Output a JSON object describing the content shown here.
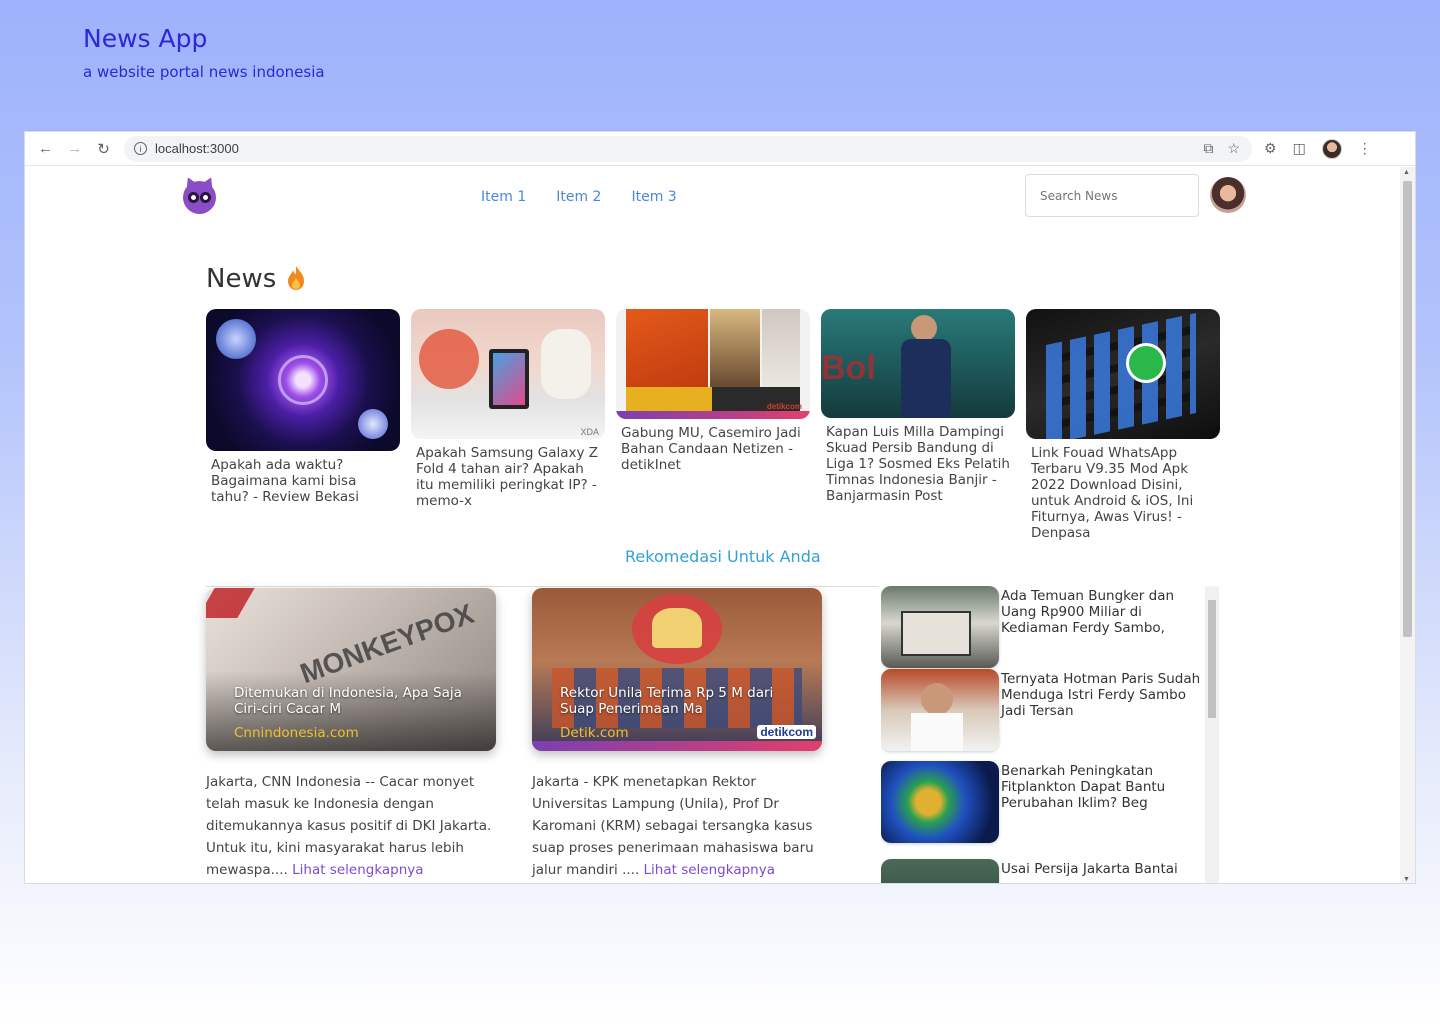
{
  "hero": {
    "title": "News App",
    "subtitle": "a website portal news indonesia"
  },
  "browser": {
    "url": "localhost:3000"
  },
  "nav": {
    "items": [
      "Item 1",
      "Item 2",
      "Item 3"
    ],
    "search_placeholder": "Search News"
  },
  "news": {
    "heading": "News",
    "cards": [
      {
        "caption": "Apakah ada waktu? Bagaimana kami bisa tahu? - Review Bekasi"
      },
      {
        "caption": "Apakah Samsung Galaxy Z Fold 4 tahan air? Apakah itu memiliki peringkat IP? - memo-x"
      },
      {
        "caption": "Gabung MU, Casemiro Jadi Bahan Candaan Netizen - detikInet"
      },
      {
        "caption": "Kapan Luis Milla Dampingi Skuad Persib Bandung di Liga 1? Sosmed Eks Pelatih Timnas Indonesia Banjir - Banjarmasin Post"
      },
      {
        "caption": "Link Fouad WhatsApp Terbaru V9.35 Mod Apk 2022 Download Disini, untuk Android & iOS, Ini Fiturnya, Awas Virus! - Denpasa"
      }
    ]
  },
  "recommend": {
    "heading": "Rekomedasi Untuk Anda",
    "cards": [
      {
        "title": "Ditemukan di Indonesia, Apa Saja Ciri-ciri Cacar M",
        "source": "Cnnindonesia.com",
        "desc": "Jakarta, CNN Indonesia -- Cacar monyet telah masuk ke Indonesia dengan ditemukannya kasus positif di DKI Jakarta. Untuk itu, kini masyarakat harus lebih mewaspa....",
        "more": "Lihat selengkapnya"
      },
      {
        "title": "Rektor Unila Terima Rp 5 M dari Suap Penerimaan Ma",
        "source": "Detik.com",
        "desc": "Jakarta - KPK menetapkan Rektor Universitas Lampung (Unila), Prof Dr Karomani (KRM) sebagai tersangka kasus suap proses penerimaan mahasiswa baru jalur mandiri ....",
        "more": "Lihat selengkapnya"
      }
    ],
    "side": [
      {
        "title": "Ada Temuan Bungker dan Uang Rp900 Miliar di Kediaman Ferdy Sambo,"
      },
      {
        "title": "Ternyata Hotman Paris Sudah Menduga Istri Ferdy Sambo Jadi Tersan"
      },
      {
        "title": "Benarkah Peningkatan Fitplankton Dapat Bantu Perubahan Iklim? Beg"
      },
      {
        "title": "Usai Persija Jakarta Bantai"
      }
    ]
  },
  "image_text": {
    "xda": "XDA",
    "detik": "detikcom",
    "monkeypox": "MONKEYPOX"
  }
}
